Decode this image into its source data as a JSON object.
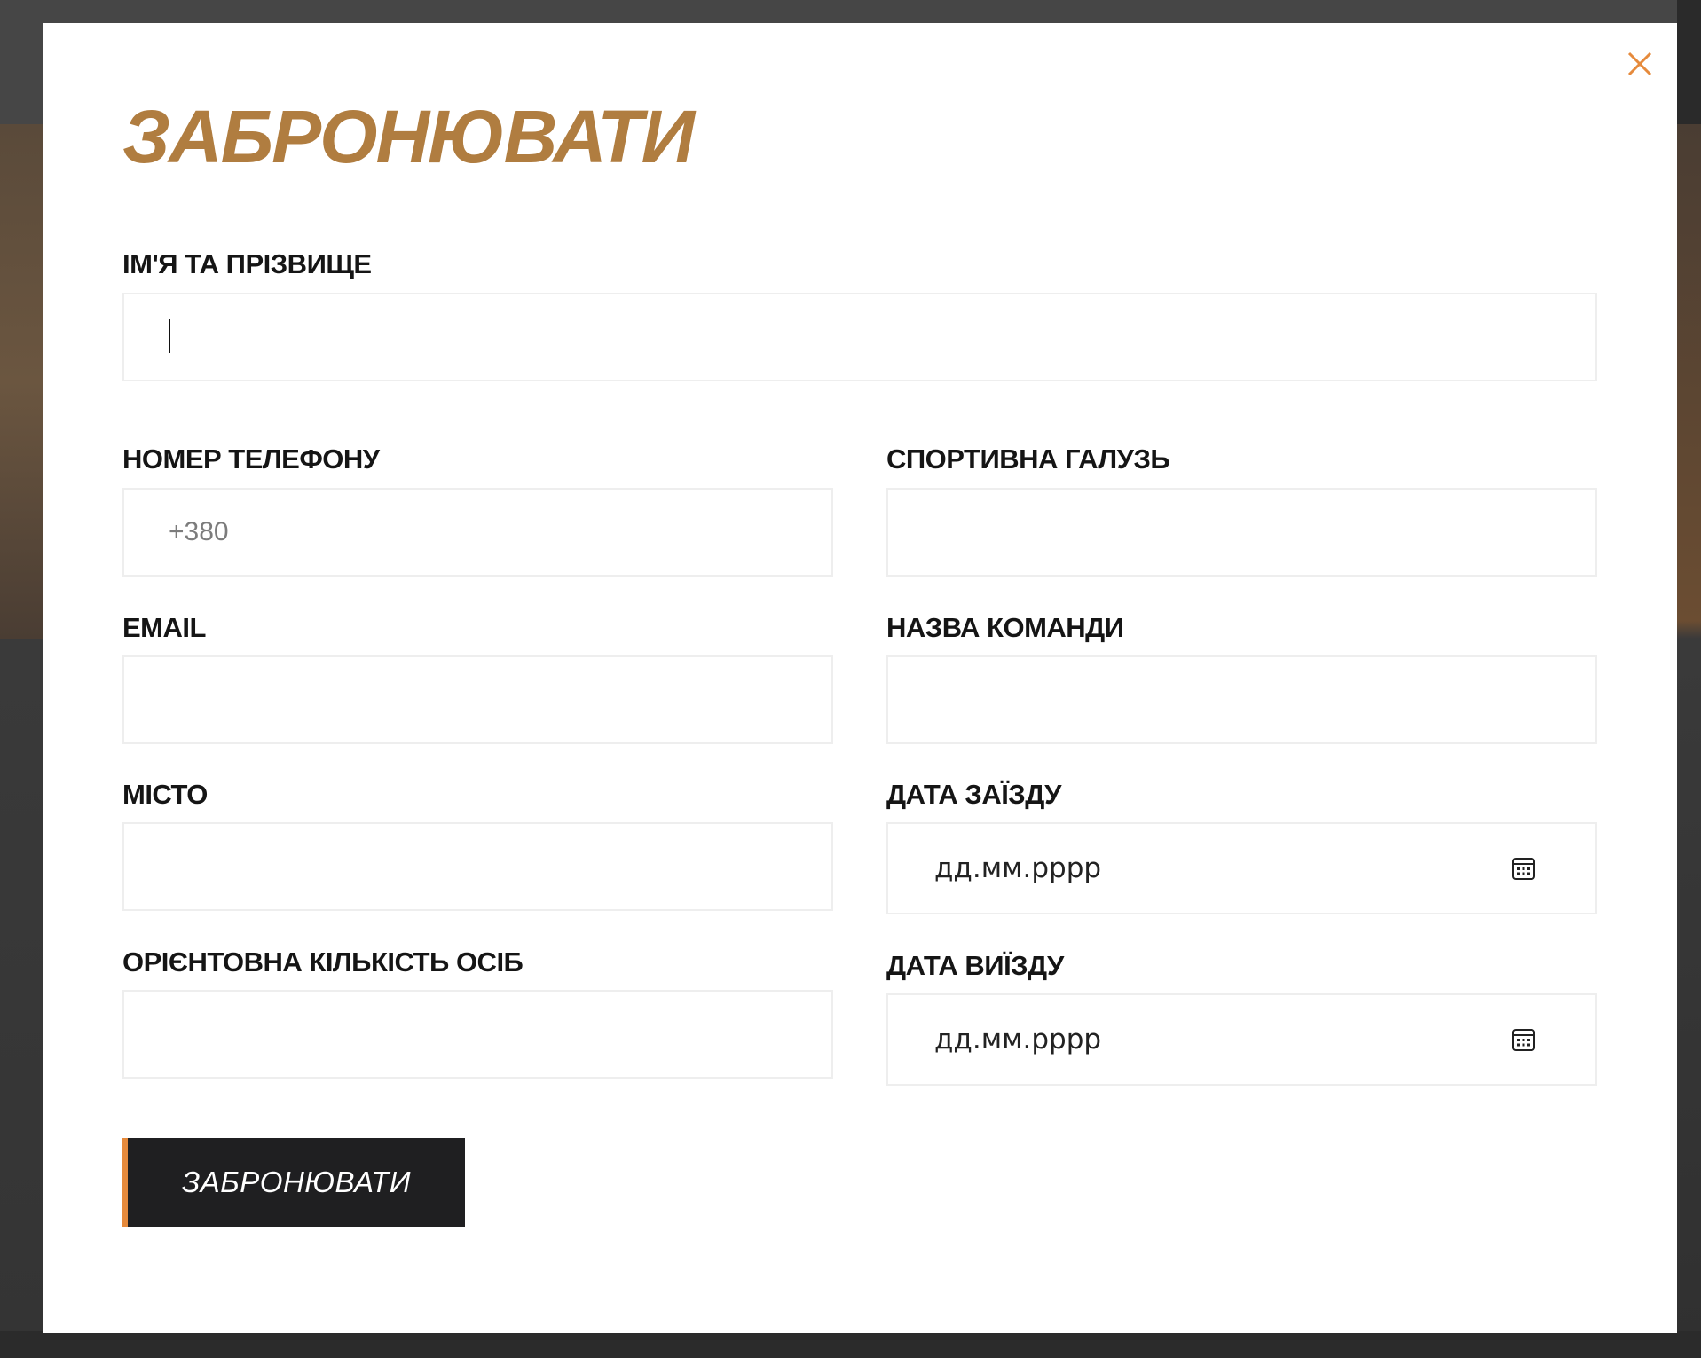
{
  "modal": {
    "title": "ЗАБРОНЮВАТИ",
    "close_icon": "close-icon"
  },
  "form": {
    "full_name": {
      "label": "ІМ'Я ТА ПРІЗВИЩЕ",
      "value": "",
      "placeholder": ""
    },
    "phone": {
      "label": "НОМЕР ТЕЛЕФОНУ",
      "value": "",
      "placeholder": "+380"
    },
    "sport": {
      "label": "СПОРТИВНА ГАЛУЗЬ",
      "value": "",
      "placeholder": ""
    },
    "email": {
      "label": "EMAIL",
      "value": "",
      "placeholder": ""
    },
    "team_name": {
      "label": "НАЗВА КОМАНДИ",
      "value": "",
      "placeholder": ""
    },
    "city": {
      "label": "МІСТО",
      "value": "",
      "placeholder": ""
    },
    "check_in": {
      "label": "ДАТА ЗАЇЗДУ",
      "value": "дд.мм.рррр",
      "icon": "calendar-icon"
    },
    "people_count": {
      "label": "ОРІЄНТОВНА КІЛЬКІСТЬ ОСІБ",
      "value": "",
      "placeholder": ""
    },
    "check_out": {
      "label": "ДАТА ВИЇЗДУ",
      "value": "дд.мм.рррр",
      "icon": "calendar-icon"
    }
  },
  "submit": {
    "label": "ЗАБРОНЮВАТИ"
  },
  "colors": {
    "accent": "#b07d40",
    "close": "#e68a3c",
    "button_bg": "#1f1f21",
    "button_border": "#e68a3c",
    "label": "#151515",
    "input_border": "#eeeeee"
  }
}
